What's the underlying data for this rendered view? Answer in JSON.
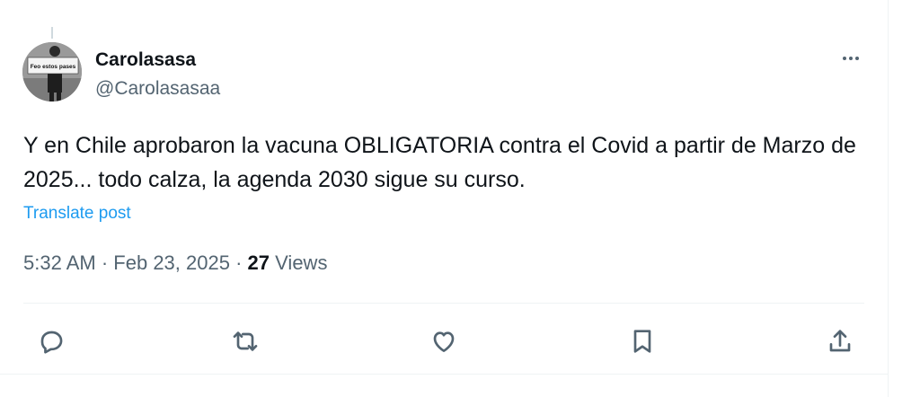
{
  "post": {
    "author": {
      "display_name": "Carolasasa",
      "handle": "@Carolasasaa",
      "avatar_sign_text": "Feo estos pases"
    },
    "text": "Y en Chile aprobaron la vacuna OBLIGATORIA contra el Covid a partir de Marzo de 2025... todo calza, la agenda 2030  sigue su curso.",
    "translate_label": "Translate post",
    "time": "5:32 AM",
    "date": "Feb 23, 2025",
    "separator": "·",
    "views_count": "27",
    "views_label": "Views"
  },
  "actions": [
    {
      "name": "reply",
      "icon": "speech-bubble-icon"
    },
    {
      "name": "repost",
      "icon": "repost-arrows-icon"
    },
    {
      "name": "like",
      "icon": "heart-icon"
    },
    {
      "name": "bookmark",
      "icon": "bookmark-icon"
    },
    {
      "name": "share",
      "icon": "share-upload-icon"
    }
  ],
  "colors": {
    "text_primary": "#0f1419",
    "text_secondary": "#536471",
    "link": "#1d9bf0",
    "divider": "#eff3f4"
  }
}
